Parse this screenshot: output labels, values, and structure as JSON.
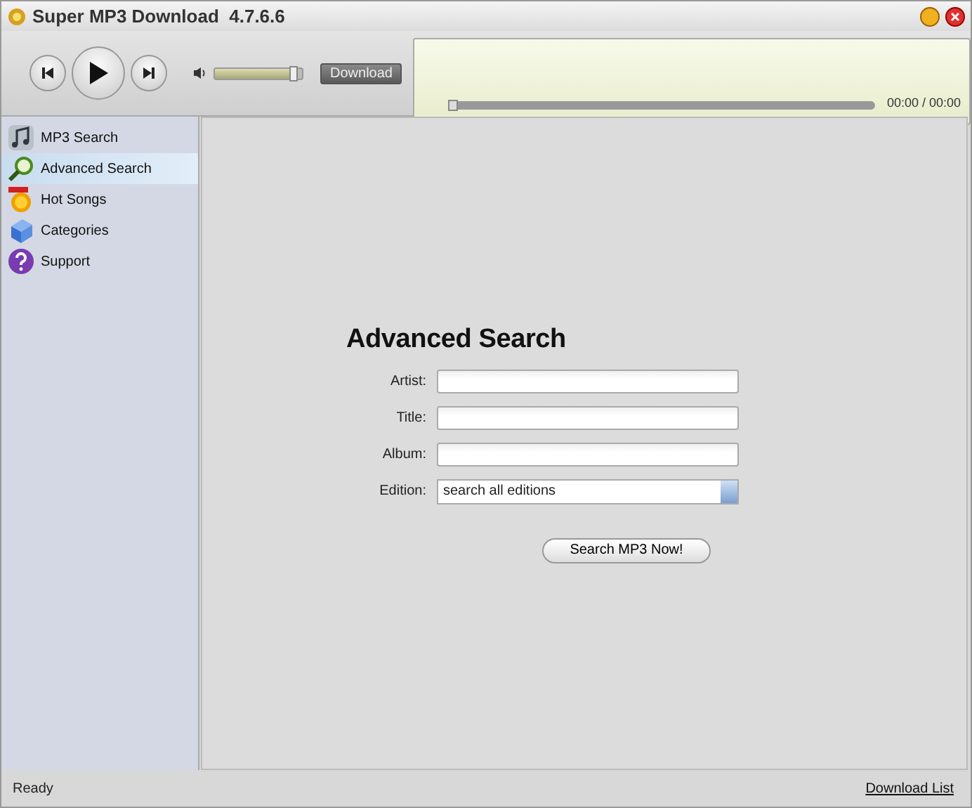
{
  "window": {
    "title": "Super MP3 Download  4.7.6.6"
  },
  "player": {
    "volume": {
      "level": 0.95
    },
    "download_button": "Download",
    "progress": {
      "level": 0.0
    },
    "time": "00:00 / 00:00"
  },
  "sidebar": {
    "items": [
      {
        "label": "MP3 Search",
        "kind": "music",
        "selected": false
      },
      {
        "label": "Advanced Search",
        "kind": "search",
        "selected": true
      },
      {
        "label": "Hot Songs",
        "kind": "hot",
        "selected": false
      },
      {
        "label": "Categories",
        "kind": "categories",
        "selected": false
      },
      {
        "label": "Support",
        "kind": "help",
        "selected": false
      }
    ]
  },
  "form": {
    "heading": "Advanced Search",
    "fields": [
      {
        "label": "Artist:",
        "kind": "text"
      },
      {
        "label": "Title:",
        "kind": "text"
      },
      {
        "label": "Album:",
        "kind": "text"
      },
      {
        "label": "Edition:",
        "kind": "select",
        "value": "search all editions"
      }
    ],
    "submit": "Search MP3 Now!"
  },
  "status_bar": {
    "text": "Ready",
    "link": "Download List"
  }
}
